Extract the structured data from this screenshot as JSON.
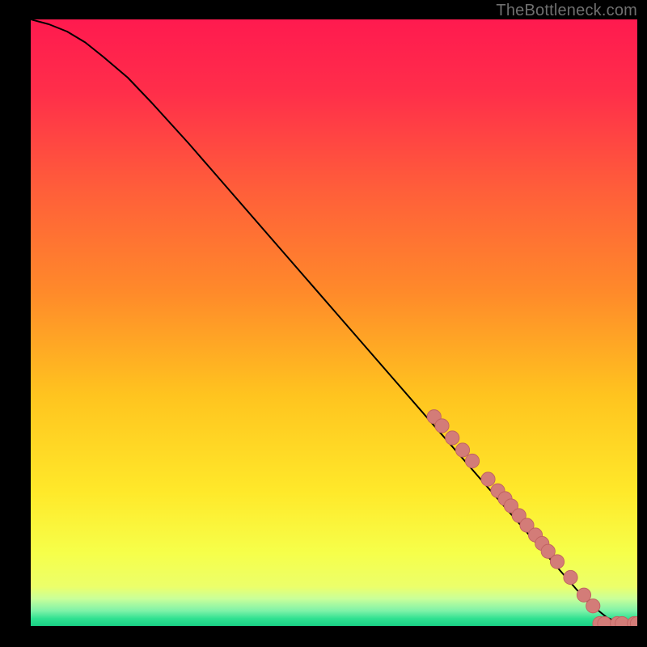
{
  "attribution": "TheBottleneck.com",
  "colors": {
    "gradient_stops": [
      {
        "offset": 0.0,
        "color": "#ff1a4f"
      },
      {
        "offset": 0.12,
        "color": "#ff2e4a"
      },
      {
        "offset": 0.28,
        "color": "#ff5e3a"
      },
      {
        "offset": 0.45,
        "color": "#ff8a2a"
      },
      {
        "offset": 0.62,
        "color": "#ffc41f"
      },
      {
        "offset": 0.78,
        "color": "#ffe92a"
      },
      {
        "offset": 0.88,
        "color": "#f6ff4a"
      },
      {
        "offset": 0.935,
        "color": "#ecff6a"
      },
      {
        "offset": 0.955,
        "color": "#c9ff9a"
      },
      {
        "offset": 0.975,
        "color": "#7ef2a8"
      },
      {
        "offset": 0.988,
        "color": "#2fe191"
      },
      {
        "offset": 1.0,
        "color": "#19cf84"
      }
    ],
    "curve": "#000000",
    "marker_fill": "#d37c78",
    "marker_stroke": "#c06361",
    "background": "#000000"
  },
  "chart_data": {
    "type": "line",
    "title": "",
    "xlabel": "",
    "ylabel": "",
    "xlim": [
      0,
      100
    ],
    "ylim": [
      0,
      100
    ],
    "grid": false,
    "legend": false,
    "series": [
      {
        "name": "curve",
        "x": [
          0,
          3,
          6,
          9,
          12,
          16,
          20,
          26,
          34,
          42,
          50,
          58,
          66,
          74,
          80,
          86,
          90,
          92,
          95,
          97,
          99,
          100
        ],
        "y": [
          100,
          99.2,
          98.0,
          96.2,
          93.8,
          90.4,
          86.2,
          79.6,
          70.4,
          61.2,
          52.0,
          42.8,
          33.6,
          24.4,
          17.5,
          10.6,
          6.0,
          3.8,
          1.4,
          0.5,
          0.2,
          0.2
        ]
      }
    ],
    "markers": [
      {
        "x": 66.5,
        "y": 34.5
      },
      {
        "x": 67.8,
        "y": 33.0
      },
      {
        "x": 69.5,
        "y": 31.0
      },
      {
        "x": 71.2,
        "y": 29.0
      },
      {
        "x": 72.8,
        "y": 27.2
      },
      {
        "x": 75.4,
        "y": 24.2
      },
      {
        "x": 77.0,
        "y": 22.3
      },
      {
        "x": 78.2,
        "y": 21.0
      },
      {
        "x": 79.2,
        "y": 19.8
      },
      {
        "x": 80.5,
        "y": 18.2
      },
      {
        "x": 81.8,
        "y": 16.6
      },
      {
        "x": 83.2,
        "y": 15.0
      },
      {
        "x": 84.3,
        "y": 13.6
      },
      {
        "x": 85.3,
        "y": 12.3
      },
      {
        "x": 86.8,
        "y": 10.6
      },
      {
        "x": 89.0,
        "y": 8.0
      },
      {
        "x": 91.2,
        "y": 5.1
      },
      {
        "x": 92.7,
        "y": 3.3
      },
      {
        "x": 93.8,
        "y": 0.4
      },
      {
        "x": 94.6,
        "y": 0.4
      },
      {
        "x": 96.7,
        "y": 0.4
      },
      {
        "x": 97.5,
        "y": 0.4
      },
      {
        "x": 99.5,
        "y": 0.4
      },
      {
        "x": 100.0,
        "y": 0.4
      }
    ],
    "annotations": []
  }
}
